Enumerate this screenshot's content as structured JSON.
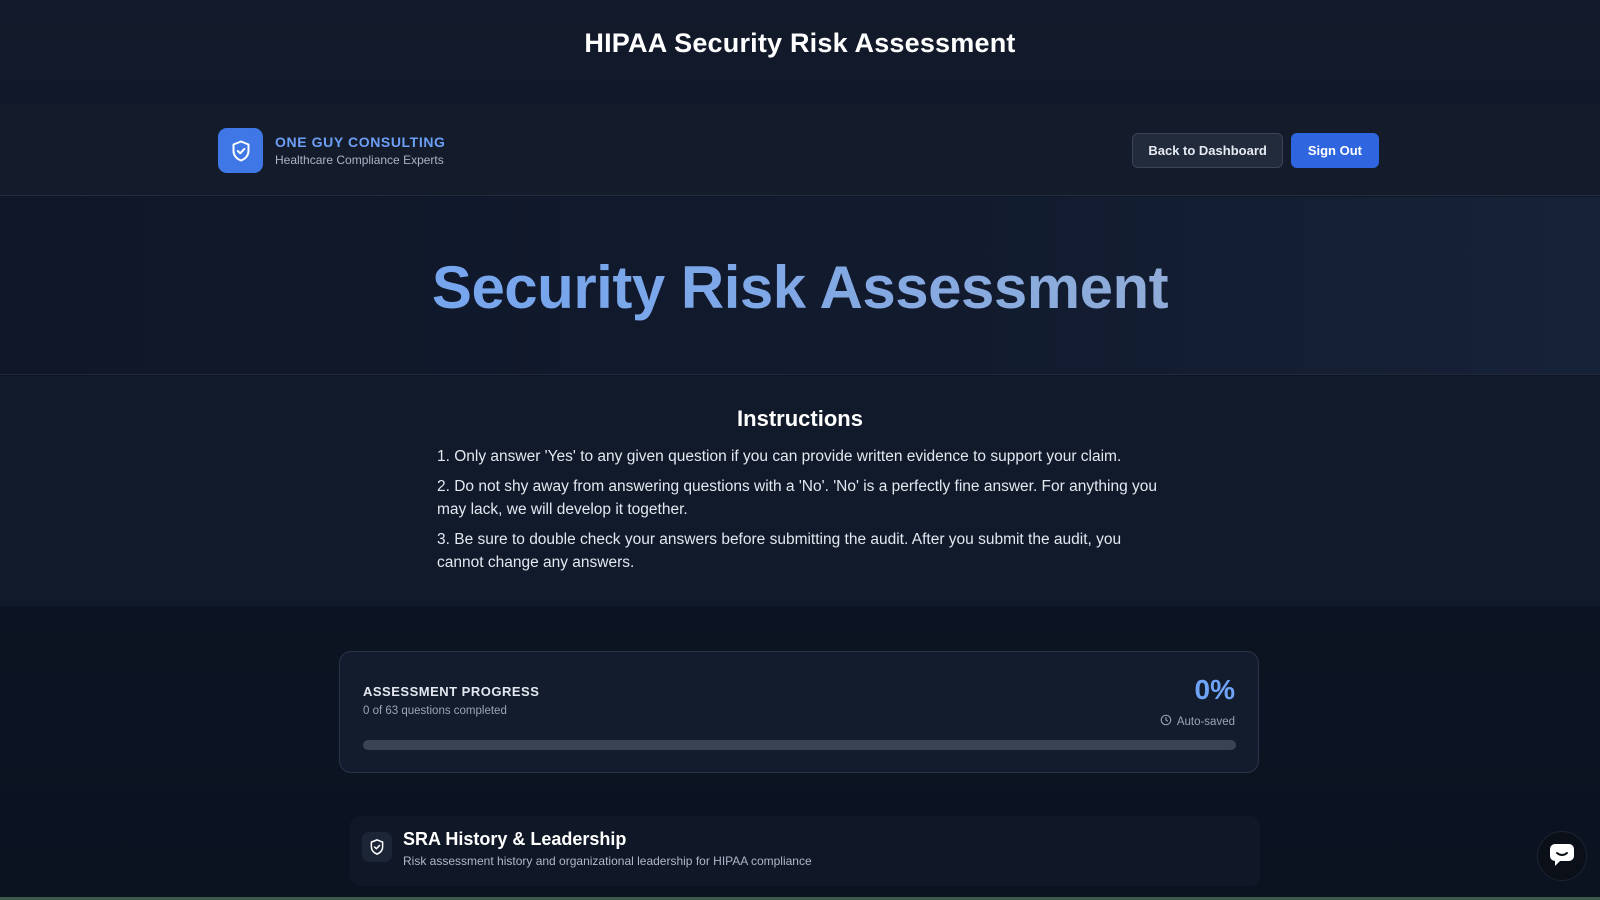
{
  "window": {
    "title": "HIPAA Security Risk Assessment"
  },
  "brand": {
    "name": "ONE GUY CONSULTING",
    "tagline": "Healthcare Compliance Experts",
    "logo_icon": "shield-check-icon"
  },
  "nav": {
    "back_label": "Back to Dashboard",
    "signout_label": "Sign Out"
  },
  "hero": {
    "title": "Security Risk Assessment"
  },
  "instructions": {
    "title": "Instructions",
    "items": [
      "1. Only answer 'Yes' to any given question if you can provide written evidence to support your claim.",
      "2. Do not shy away from answering questions with a 'No'. 'No' is a perfectly fine answer. For anything you may lack, we will develop it together.",
      "3. Be sure to double check your answers before submitting the audit. After you submit the audit, you cannot change any answers."
    ]
  },
  "progress": {
    "label": "ASSESSMENT PROGRESS",
    "completed_text": "0 of 63 questions completed",
    "percent_text": "0%",
    "fraction": 0,
    "saved_text": "Auto-saved",
    "saved_icon": "clock-icon"
  },
  "section": {
    "title": "SRA History & Leadership",
    "description": "Risk assessment history and organizational leadership for HIPAA compliance",
    "icon": "shield-check-icon"
  },
  "chat": {
    "icon": "chat-icon"
  },
  "colors": {
    "accent": "#3f78e6",
    "brand_text": "#6d9ff6",
    "background": "#0c1322"
  }
}
